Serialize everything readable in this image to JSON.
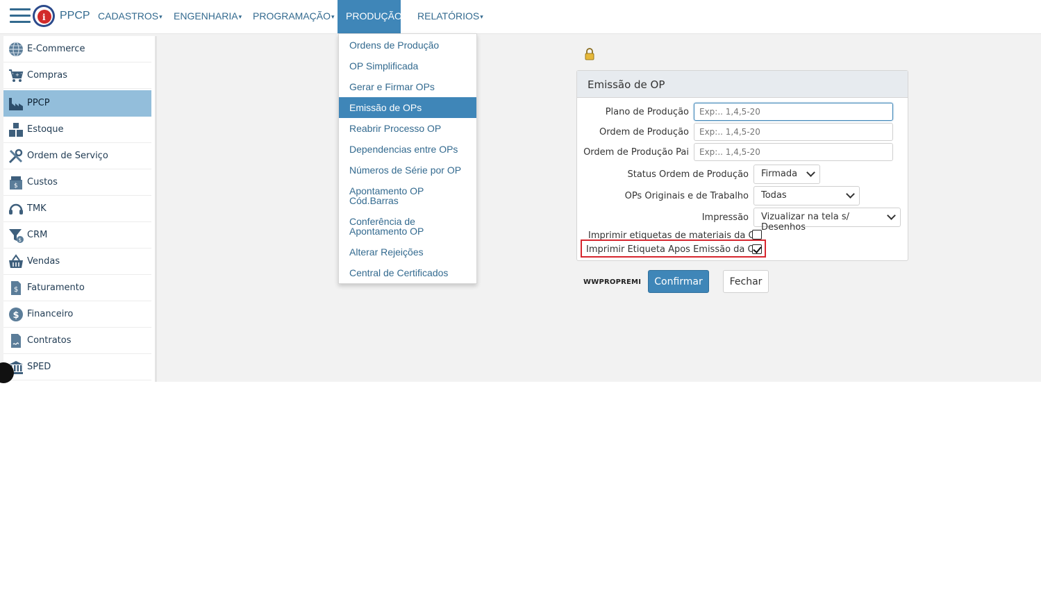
{
  "header": {
    "app_name": "PPCP",
    "menu": [
      {
        "label": "CADASTROS"
      },
      {
        "label": "ENGENHARIA"
      },
      {
        "label": "PROGRAMAÇÃO"
      },
      {
        "label": "PRODUÇÃO",
        "active": true
      },
      {
        "label": "RELATÓRIOS"
      }
    ],
    "caret": "▾"
  },
  "sidebar": {
    "items": [
      {
        "label": "E-Commerce",
        "icon": "globe-icon"
      },
      {
        "label": "Compras",
        "icon": "cart-icon"
      },
      {
        "label": "PPCP",
        "icon": "factory-icon",
        "active": true
      },
      {
        "label": "Estoque",
        "icon": "boxes-icon"
      },
      {
        "label": "Ordem de Serviço",
        "icon": "tools-icon"
      },
      {
        "label": "Custos",
        "icon": "cash-box-icon"
      },
      {
        "label": "TMK",
        "icon": "headset-icon"
      },
      {
        "label": "CRM",
        "icon": "funnel-icon"
      },
      {
        "label": "Vendas",
        "icon": "basket-icon"
      },
      {
        "label": "Faturamento",
        "icon": "invoice-icon"
      },
      {
        "label": "Financeiro",
        "icon": "dollar-icon"
      },
      {
        "label": "Contratos",
        "icon": "contract-icon"
      },
      {
        "label": "SPED",
        "icon": "bank-icon"
      }
    ]
  },
  "dropdown": {
    "items": [
      {
        "label": "Ordens de Produção"
      },
      {
        "label": "OP Simplificada"
      },
      {
        "label": "Gerar e Firmar OPs"
      },
      {
        "label": "Emissão de OPs",
        "active": true
      },
      {
        "label": "Reabrir Processo OP"
      },
      {
        "label": "Dependencias entre OPs"
      },
      {
        "label": "Números de Série por OP"
      },
      {
        "label_line1": "Apontamento OP",
        "label_line2": "Cód.Barras"
      },
      {
        "label_line1": "Conferência de",
        "label_line2": "Apontamento OP"
      },
      {
        "label": "Alterar Rejeições"
      },
      {
        "label": "Central de Certificados"
      }
    ]
  },
  "panel": {
    "title": "Emissão de OP",
    "plano_label": "Plano de Produção",
    "plano_placeholder": "Exp:.. 1,4,5-20",
    "ordem_label": "Ordem de Produção",
    "ordem_placeholder": "Exp:.. 1,4,5-20",
    "ordem_pai_label": "Ordem de Produção Pai",
    "ordem_pai_placeholder": "Exp:.. 1,4,5-20",
    "status_label": "Status Ordem de Produção",
    "status_value": "Firmada",
    "originais_label": "OPs Originais e de Trabalho",
    "originais_value": "Todas",
    "impressao_label": "Impressão",
    "impressao_value": "Vizualizar na tela s/ Desenhos",
    "etiquetas_label": "Imprimir etiquetas de materiais da OP",
    "etiquetas_checked": false,
    "etiqueta_apos_label": "Imprimir Etiqueta Apos Emissão da Op",
    "etiqueta_apos_checked": true
  },
  "footer": {
    "form_code": "WWPROPREMI",
    "confirm_label": "Confirmar",
    "close_label": "Fechar"
  },
  "colors": {
    "accent": "#3f86b8",
    "sidebar_active": "#93bedb",
    "highlight": "#d6262e"
  }
}
